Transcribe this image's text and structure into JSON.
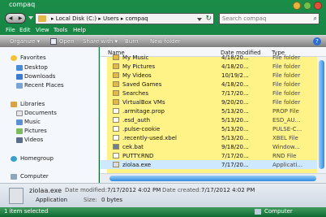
{
  "window": {
    "title": "compaq"
  },
  "address": {
    "path": "▸ Local Disk (C:) ▸ Users ▸ compaq",
    "search_placeholder": "Search compaq"
  },
  "menu": [
    "File",
    "Edit",
    "View",
    "Tools",
    "Help"
  ],
  "toolbar": {
    "organize": "Organize ▾",
    "open": "Open",
    "share": "Share with ▾",
    "burn": "Burn",
    "new_folder": "New folder"
  },
  "navpane": {
    "favorites": "Favorites",
    "desktop": "Desktop",
    "downloads": "Downloads",
    "recent": "Recent Places",
    "libraries": "Libraries",
    "documents": "Documents",
    "music": "Music",
    "pictures": "Pictures",
    "videos": "Videos",
    "homegroup": "Homegroup",
    "computer": "Computer"
  },
  "columns": {
    "name": "Name",
    "date": "Date modified",
    "type": "Type"
  },
  "files": [
    {
      "name": "My Music",
      "date": "4/18/20...",
      "type": "File folder",
      "icon": "folder"
    },
    {
      "name": "My Pictures",
      "date": "4/18/20...",
      "type": "File folder",
      "icon": "folder"
    },
    {
      "name": "My Videos",
      "date": "10/19/2...",
      "type": "File folder",
      "icon": "folder"
    },
    {
      "name": "Saved Games",
      "date": "4/18/20...",
      "type": "File folder",
      "icon": "folder"
    },
    {
      "name": "Searches",
      "date": "7/17/20...",
      "type": "File folder",
      "icon": "folder"
    },
    {
      "name": "VirtualBox VMs",
      "date": "9/20/20...",
      "type": "File folder",
      "icon": "folder"
    },
    {
      "name": ".armitage.prop",
      "date": "5/13/20...",
      "type": "PROP File",
      "icon": "file"
    },
    {
      "name": ".esd_auth",
      "date": "5/13/20...",
      "type": "ESD_AU...",
      "icon": "file"
    },
    {
      "name": ".pulse-cookie",
      "date": "5/13/20...",
      "type": "PULSE-C...",
      "icon": "file"
    },
    {
      "name": ".recently-used.xbel",
      "date": "5/13/20...",
      "type": "XBEL File",
      "icon": "file"
    },
    {
      "name": "cek.bat",
      "date": "9/18/20...",
      "type": "Window...",
      "icon": "bat"
    },
    {
      "name": "PUTTY.RND",
      "date": "7/17/20...",
      "type": "RND File",
      "icon": "file"
    },
    {
      "name": "ziolaa.exe",
      "date": "7/17/20...",
      "type": "Applicati...",
      "icon": "exe"
    }
  ],
  "details": {
    "filename": "ziolaa.exe",
    "modified_label": "Date modified:",
    "modified": "7/17/2012 4:02 PM",
    "created_label": "Date created:",
    "created": "7/17/2012 4:02 PM",
    "kind": "Application",
    "size_label": "Size:",
    "size": "0 bytes"
  },
  "status": {
    "selection": "1 item selected",
    "location": "Computer"
  },
  "colors": {
    "chrome_green": "#1a8d49",
    "highlight": "#fff173",
    "folder": "#e2b84a"
  }
}
